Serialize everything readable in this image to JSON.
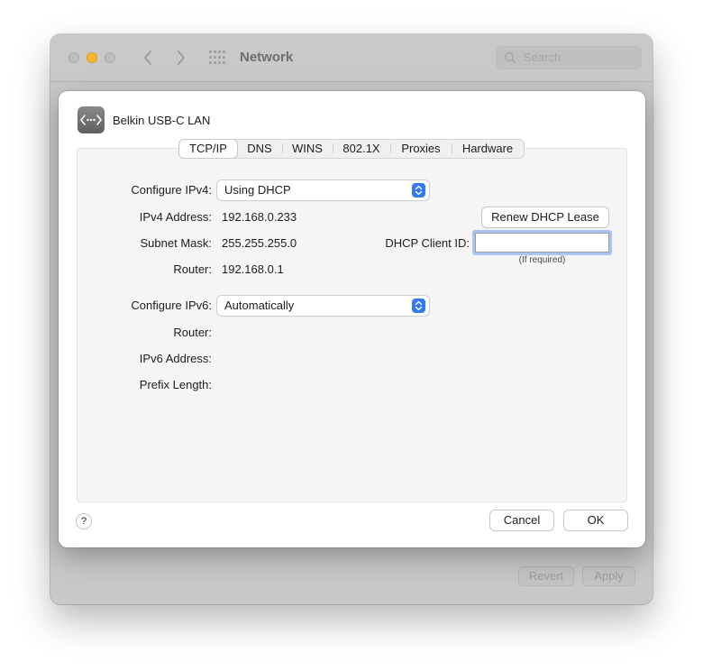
{
  "window": {
    "title": "Network",
    "search_placeholder": "Search",
    "revert_label": "Revert",
    "apply_label": "Apply"
  },
  "sheet": {
    "interface_name": "Belkin USB-C LAN",
    "tabs": [
      {
        "label": "TCP/IP",
        "active": true
      },
      {
        "label": "DNS",
        "active": false
      },
      {
        "label": "WINS",
        "active": false
      },
      {
        "label": "802.1X",
        "active": false
      },
      {
        "label": "Proxies",
        "active": false
      },
      {
        "label": "Hardware",
        "active": false
      }
    ],
    "ipv4": {
      "configure_label": "Configure IPv4:",
      "configure_value": "Using DHCP",
      "address_label": "IPv4 Address:",
      "address_value": "192.168.0.233",
      "subnet_label": "Subnet Mask:",
      "subnet_value": "255.255.255.0",
      "router_label": "Router:",
      "router_value": "192.168.0.1",
      "renew_button": "Renew DHCP Lease",
      "client_id_label": "DHCP Client ID:",
      "client_id_value": "",
      "client_id_hint": "(If required)"
    },
    "ipv6": {
      "configure_label": "Configure IPv6:",
      "configure_value": "Automatically",
      "router_label": "Router:",
      "address_label": "IPv6 Address:",
      "prefix_label": "Prefix Length:"
    },
    "help_label": "?",
    "cancel_label": "Cancel",
    "ok_label": "OK"
  },
  "colors": {
    "accent": "#3478f6",
    "minimize": "#f5b731"
  },
  "icons": [
    "chevron-left-icon",
    "chevron-right-icon",
    "grid-icon",
    "search-icon",
    "ethernet-icon",
    "up-down-chevron-icon"
  ]
}
